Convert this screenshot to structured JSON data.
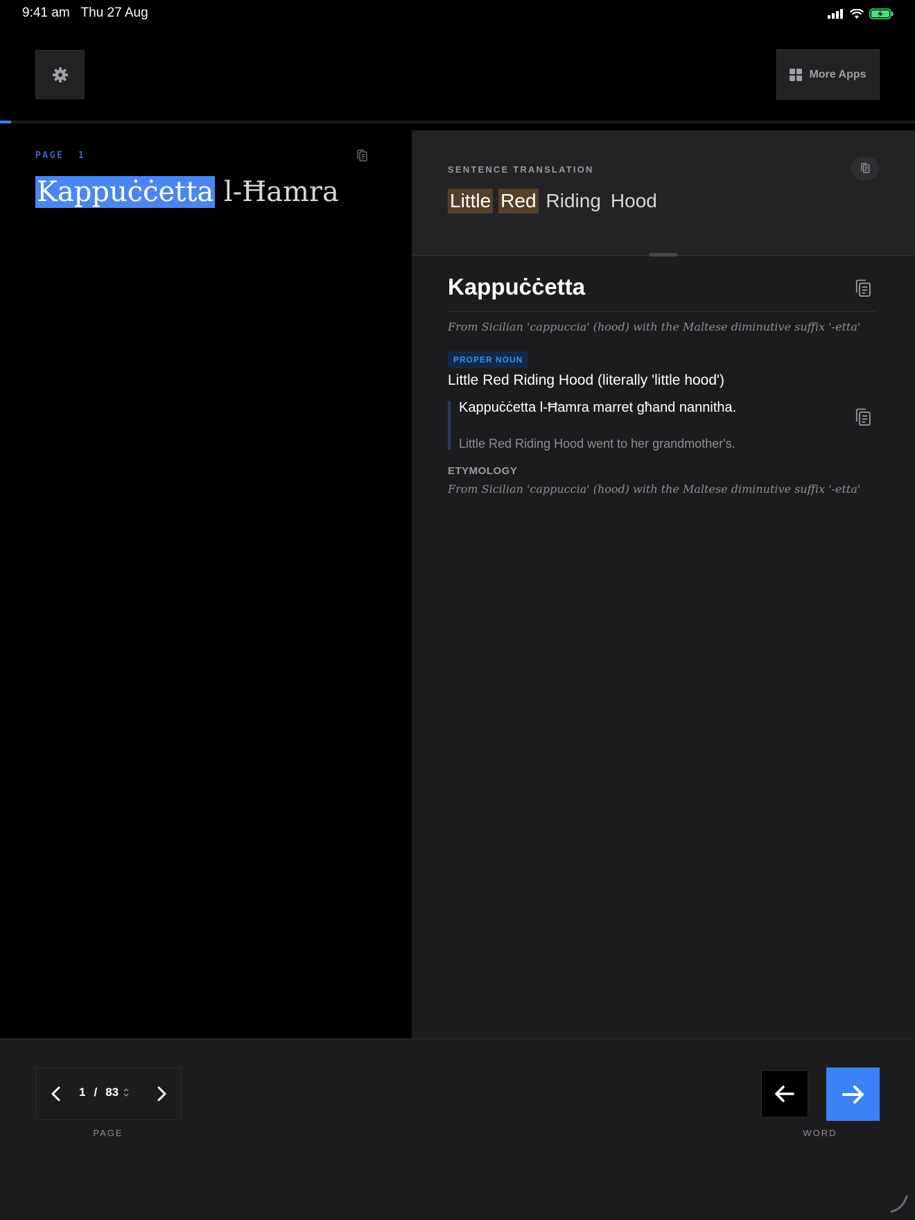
{
  "status_bar": {
    "time": "9:41 am",
    "date": "Thu 27 Aug"
  },
  "toolbar": {
    "more_apps_label": "More Apps",
    "reading_progress": 0.012
  },
  "reader": {
    "page_label": "PAGE",
    "page_number": "1",
    "source_words": [
      "Kappuċċetta",
      "l-Ħamra"
    ],
    "selected_word_index": 0
  },
  "translation": {
    "label": "SENTENCE TRANSLATION",
    "words": [
      {
        "text": "Little",
        "highlighted": true
      },
      {
        "text": "Red",
        "highlighted": true
      },
      {
        "text": "Riding",
        "highlighted": false
      },
      {
        "text": "Hood",
        "highlighted": false
      }
    ]
  },
  "dictionary": {
    "headword": "Kappuċċetta",
    "etymology_short": "From Sicilian 'cappuccia' (hood) with the Maltese diminutive suffix '-etta'",
    "part_of_speech": "PROPER NOUN",
    "definition": "Little Red Riding Hood (literally 'little hood')",
    "example_source": "Kappuċċetta l-Ħamra marret għand nannitha.",
    "example_translation": "Little Red Riding Hood went to her grandmother's.",
    "etymology_label": "ETYMOLOGY",
    "etymology_full": "From Sicilian 'cappuccia' (hood) with the Maltese diminutive suffix '-etta'"
  },
  "footer": {
    "page_current": "1",
    "page_separator": "/",
    "page_total": "83",
    "page_label": "PAGE",
    "word_label": "WORD"
  },
  "icons": {
    "settings": "gear-icon",
    "more_apps": "grid-icon",
    "copy": "copy-icon",
    "prev": "chevron-left-icon",
    "next": "chevron-right-icon",
    "prev_word": "arrow-left-icon",
    "next_word": "arrow-right-icon"
  },
  "colors": {
    "accent": "#3b82f6",
    "known_word": "#55402c",
    "background": "#000000",
    "panel": "#1c1c1e"
  }
}
